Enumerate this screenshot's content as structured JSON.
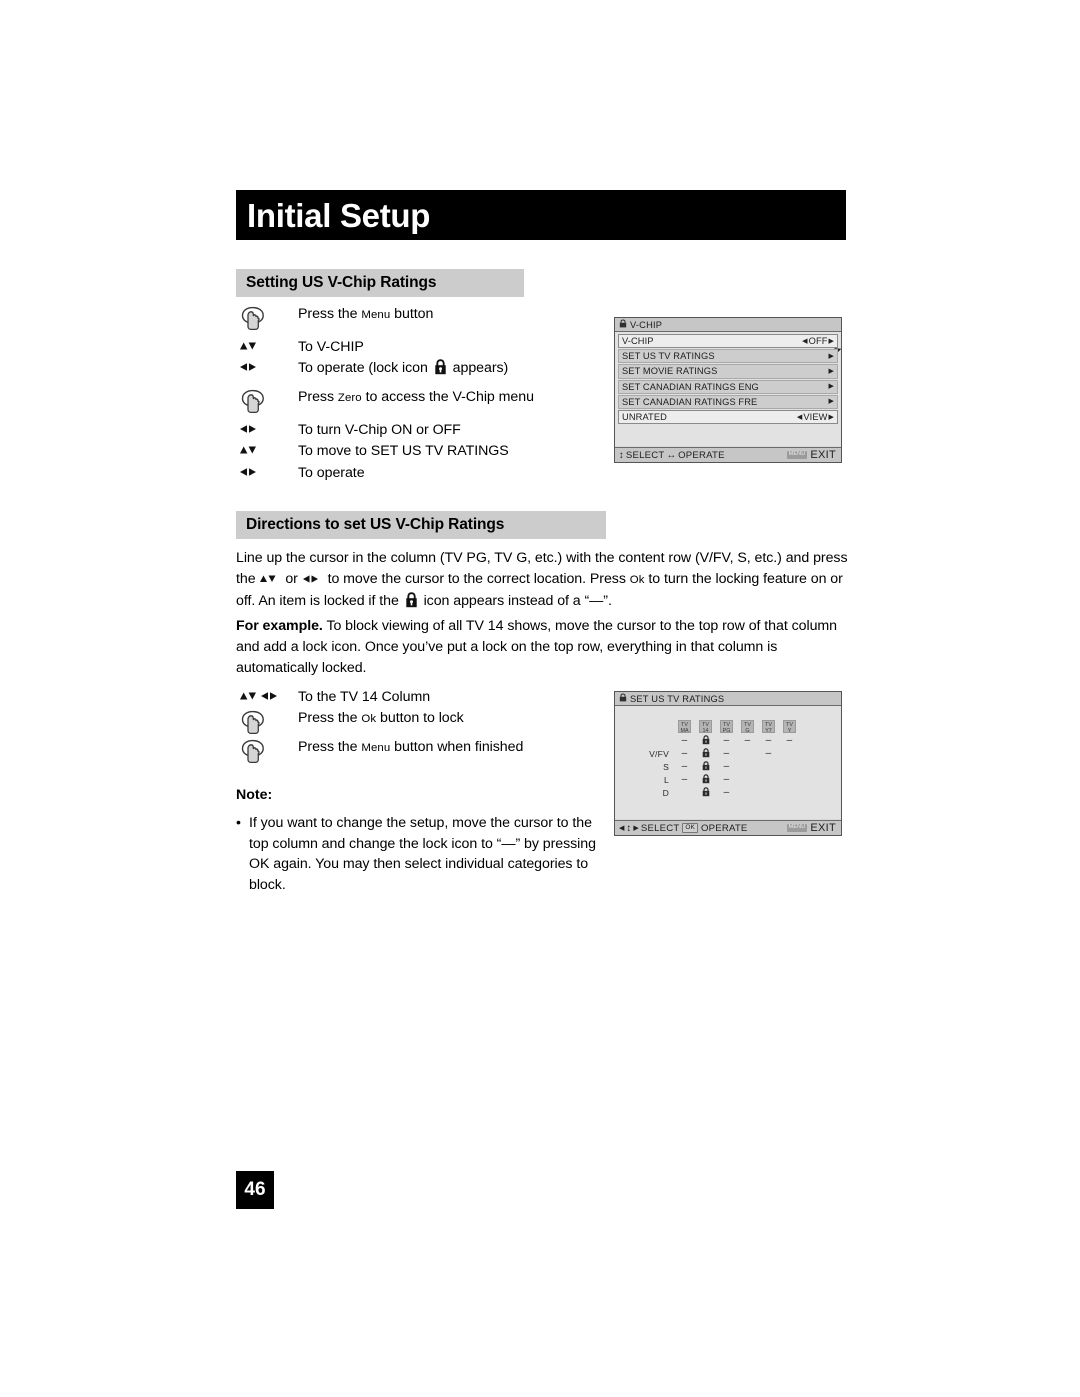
{
  "chapter": {
    "title": "Initial Setup"
  },
  "sections": {
    "setting": {
      "heading": "Setting US V-Chip Ratings"
    },
    "directions": {
      "heading": "Directions to set US V-Chip Ratings"
    }
  },
  "steps_setting": [
    {
      "icon": "hand-press-icon",
      "text_pre": "Press the ",
      "text_sc": "Menu",
      "text_post": " button"
    },
    {
      "icon": "up-down-arrows-icon",
      "text_pre": "To V-CHIP",
      "text_sc": "",
      "text_post": ""
    },
    {
      "icon": "left-right-arrows-icon",
      "text_pre": "To operate (lock icon ",
      "text_sc": "",
      "text_post": " appears)",
      "has_lock": true
    },
    {
      "icon": "hand-press-icon",
      "text_pre": "Press ",
      "text_sc": "Zero",
      "text_post": " to access the V-Chip menu"
    },
    {
      "icon": "left-right-arrows-icon",
      "text_pre": "To turn V-Chip ON or OFF",
      "text_sc": "",
      "text_post": ""
    },
    {
      "icon": "up-down-arrows-icon",
      "text_pre": "To move to SET US TV RATINGS",
      "text_sc": "",
      "text_post": ""
    },
    {
      "icon": "left-right-arrows-icon",
      "text_pre": "To operate",
      "text_sc": "",
      "text_post": ""
    }
  ],
  "steps_directions": [
    {
      "icon": "four-way-arrows-icon",
      "text_pre": "To the TV 14 Column",
      "text_sc": "",
      "text_post": ""
    },
    {
      "icon": "hand-press-icon",
      "text_pre": "Press the ",
      "text_sc": "Ok",
      "text_post": " button to lock"
    },
    {
      "icon": "hand-press-icon",
      "text_pre": "Press the ",
      "text_sc": "Menu",
      "text_post": " button when finished"
    }
  ],
  "paragraphs": {
    "directions_a": "Line up the cursor in the column (TV PG, TV G, etc.) with the content row (V/FV, S, etc.) and press the ",
    "directions_b": " or ",
    "directions_c": " to move the cursor to the correct location. Press ",
    "directions_ok": "Ok",
    "directions_d": " to turn the locking feature on or off. An item is locked if the ",
    "directions_e": " icon appears instead of a “—”.",
    "example_bold": "For example.",
    "example_rest": " To block viewing of all TV 14 shows, move the cursor to the top row of that column and add a lock icon. Once you’ve put a lock on the top row, everything in that column is automatically locked."
  },
  "note": {
    "title": "Note:",
    "bullet": "•",
    "items": [
      "If you want to change the setup, move the cursor to the top column and change the lock icon to “—” by pressing OK again. You may then select individual categories to block."
    ]
  },
  "osd_vchip": {
    "title": "V-CHIP",
    "rows": [
      {
        "label": "V-CHIP",
        "value": "OFF",
        "selected": true,
        "left_tri": "◀",
        "right_tri": "▶",
        "arrow_only": false
      },
      {
        "label": "SET US TV RATINGS",
        "value": "",
        "selected": false,
        "left_tri": "",
        "right_tri": "▶",
        "arrow_only": true
      },
      {
        "label": "SET MOVIE RATINGS",
        "value": "",
        "selected": false,
        "left_tri": "",
        "right_tri": "▶",
        "arrow_only": true
      },
      {
        "label": "SET CANADIAN RATINGS ENG",
        "value": "",
        "selected": false,
        "left_tri": "",
        "right_tri": "▶",
        "arrow_only": true
      },
      {
        "label": "SET CANADIAN RATINGS FRE",
        "value": "",
        "selected": false,
        "left_tri": "",
        "right_tri": "▶",
        "arrow_only": true
      },
      {
        "label": "UNRATED",
        "value": "VIEW",
        "selected": true,
        "left_tri": "◀",
        "right_tri": "▶",
        "arrow_only": false
      }
    ],
    "footer": {
      "select_arrow": "↕",
      "select": "SELECT",
      "operate_arrow": "↔",
      "operate": "OPERATE",
      "exit_key": "MENU",
      "exit": "EXIT"
    }
  },
  "osd_ratings": {
    "title": "SET US TV RATINGS",
    "columns": [
      {
        "line1": "TV",
        "line2": "MA"
      },
      {
        "line1": "TV",
        "line2": "14"
      },
      {
        "line1": "TV",
        "line2": "PG"
      },
      {
        "line1": "TV",
        "line2": "G"
      },
      {
        "line1": "TV",
        "line2": "Y7"
      },
      {
        "line1": "TV",
        "line2": "Y"
      }
    ],
    "rows": [
      {
        "label": "",
        "cells": [
          "dash",
          "lock",
          "dash",
          "dash",
          "dash",
          "dash"
        ]
      },
      {
        "label": "V/FV",
        "cells": [
          "dash",
          "lock",
          "dash",
          "",
          "dash",
          ""
        ]
      },
      {
        "label": "S",
        "cells": [
          "dash",
          "lock",
          "dash",
          "",
          "",
          ""
        ]
      },
      {
        "label": "L",
        "cells": [
          "dash",
          "lock",
          "dash",
          "",
          "",
          ""
        ]
      },
      {
        "label": "D",
        "cells": [
          "",
          "lock",
          "dash",
          "",
          "",
          ""
        ]
      }
    ],
    "dash_glyph": "–",
    "footer": {
      "select_arrow_left": "◀",
      "select_arrow_ud": "↕",
      "select_arrow_right": "▶",
      "select": "SELECT",
      "ok_badge": "OK",
      "operate": "OPERATE",
      "exit_key": "MENU",
      "exit": "EXIT"
    }
  },
  "page_number": "46",
  "colors": {
    "title_bar_bg": "#000000",
    "section_head_bg": "#cccccc",
    "osd_bg": "#e2e2e2",
    "osd_chrome": "#c6c6c6",
    "text": "#000000"
  }
}
